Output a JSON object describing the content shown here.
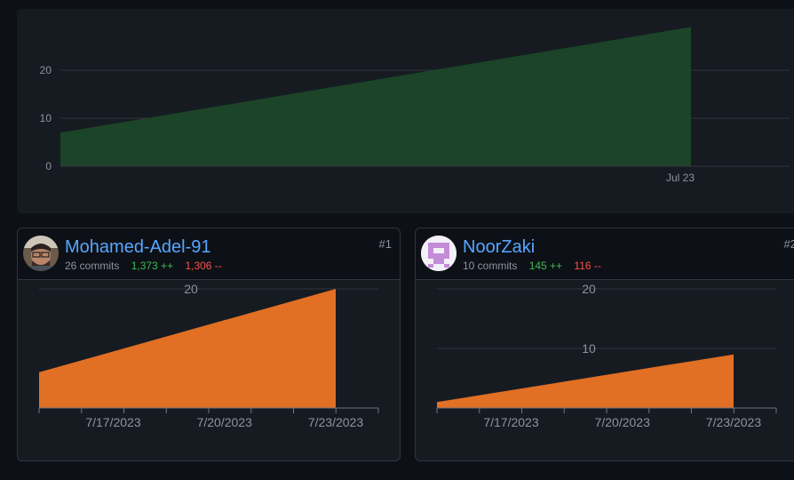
{
  "chart_data": [
    {
      "type": "area",
      "x": [
        "7/15/2023",
        "7/23/2023"
      ],
      "values": [
        7,
        29
      ],
      "x_tick_labels": [
        "Jul 23"
      ],
      "y_ticks": [
        0,
        10,
        20
      ],
      "ylim": [
        0,
        30
      ],
      "grid": true,
      "color": "#1c4428",
      "title": "",
      "xlabel": "",
      "ylabel": ""
    },
    {
      "type": "area",
      "x": [
        "7/15/2023",
        "7/23/2023"
      ],
      "values": [
        6,
        20
      ],
      "x_tick_labels": [
        "7/17/2023",
        "7/20/2023",
        "7/23/2023"
      ],
      "y_ticks": [
        20
      ],
      "ylim": [
        0,
        20
      ],
      "grid": true,
      "color": "#e16f24"
    },
    {
      "type": "area",
      "x": [
        "7/15/2023",
        "7/23/2023"
      ],
      "values": [
        1,
        9
      ],
      "x_tick_labels": [
        "7/17/2023",
        "7/20/2023",
        "7/23/2023"
      ],
      "y_ticks": [
        10,
        20
      ],
      "ylim": [
        0,
        20
      ],
      "grid": true,
      "color": "#e16f24"
    }
  ],
  "contributors": [
    {
      "name": "Mohamed-Adel-91",
      "commits": "26 commits",
      "additions": "1,373 ++",
      "deletions": "1,306 --",
      "rank": "#1"
    },
    {
      "name": "NoorZaki",
      "commits": "10 commits",
      "additions": "145 ++",
      "deletions": "116 --",
      "rank": "#2"
    }
  ],
  "colors": {
    "link": "#58a6ff",
    "additions": "#3fb950",
    "deletions": "#f85149",
    "area_overview": "#1c4428",
    "area_contributor": "#e16f24"
  }
}
